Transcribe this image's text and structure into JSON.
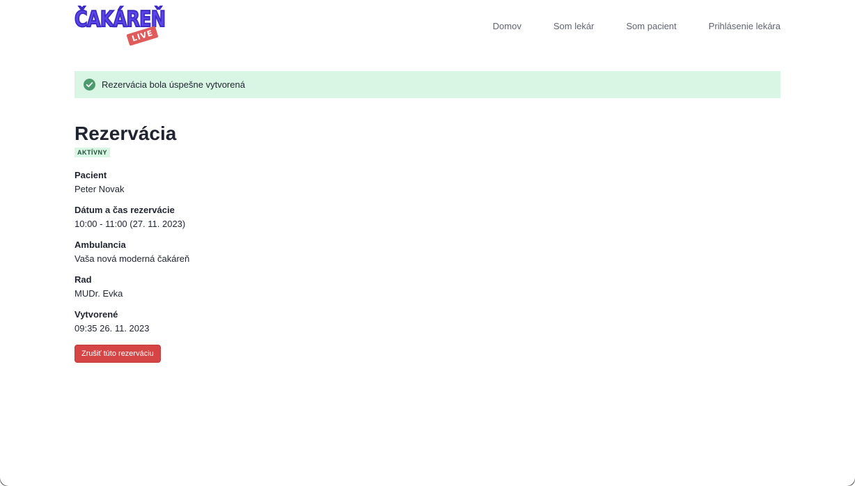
{
  "logo": {
    "main": "ČAKÁREŇ",
    "badge": "LIVE"
  },
  "nav": {
    "items": [
      {
        "label": "Domov"
      },
      {
        "label": "Som lekár"
      },
      {
        "label": "Som pacient"
      },
      {
        "label": "Prihlásenie lekára"
      }
    ]
  },
  "alert": {
    "icon": "check-circle-icon",
    "text": "Rezervácia bola úspešne vytvorená",
    "background": "#d9f6e5",
    "icon_color": "#4c9a6e"
  },
  "reservation": {
    "title": "Rezervácia",
    "status": "AKTÍVNY",
    "fields": [
      {
        "label": "Pacient",
        "value": "Peter Novak"
      },
      {
        "label": "Dátum a čas rezervácie",
        "value": "10:00 - 11:00 (27. 11. 2023)"
      },
      {
        "label": "Ambulancia",
        "value": "Vaša nová moderná čakáreň"
      },
      {
        "label": "Rad",
        "value": "MUDr. Evka"
      },
      {
        "label": "Vytvorené",
        "value": "09:35 26. 11. 2023"
      }
    ],
    "cancel_label": "Zrušiť túto rezerváciu"
  },
  "colors": {
    "brand": "#5b45e6",
    "live_badge": "#e05b5b",
    "danger": "#d64545",
    "success_bg": "#d9f6e5"
  }
}
